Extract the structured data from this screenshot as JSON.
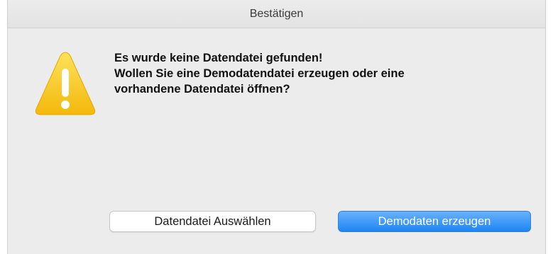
{
  "dialog": {
    "title": "Bestätigen",
    "message_lines": [
      "Es wurde keine Datendatei gefunden!",
      "Wollen Sie eine Demodatendatei erzeugen oder eine",
      "vorhandene Datendatei öffnen?"
    ],
    "icon": "warning-icon",
    "buttons": {
      "secondary_label": "Datendatei Auswählen",
      "primary_label": "Demodaten erzeugen"
    }
  },
  "colors": {
    "primary_button": "#1d86f3",
    "warning_yellow": "#f7c61a",
    "background": "#ececec"
  }
}
